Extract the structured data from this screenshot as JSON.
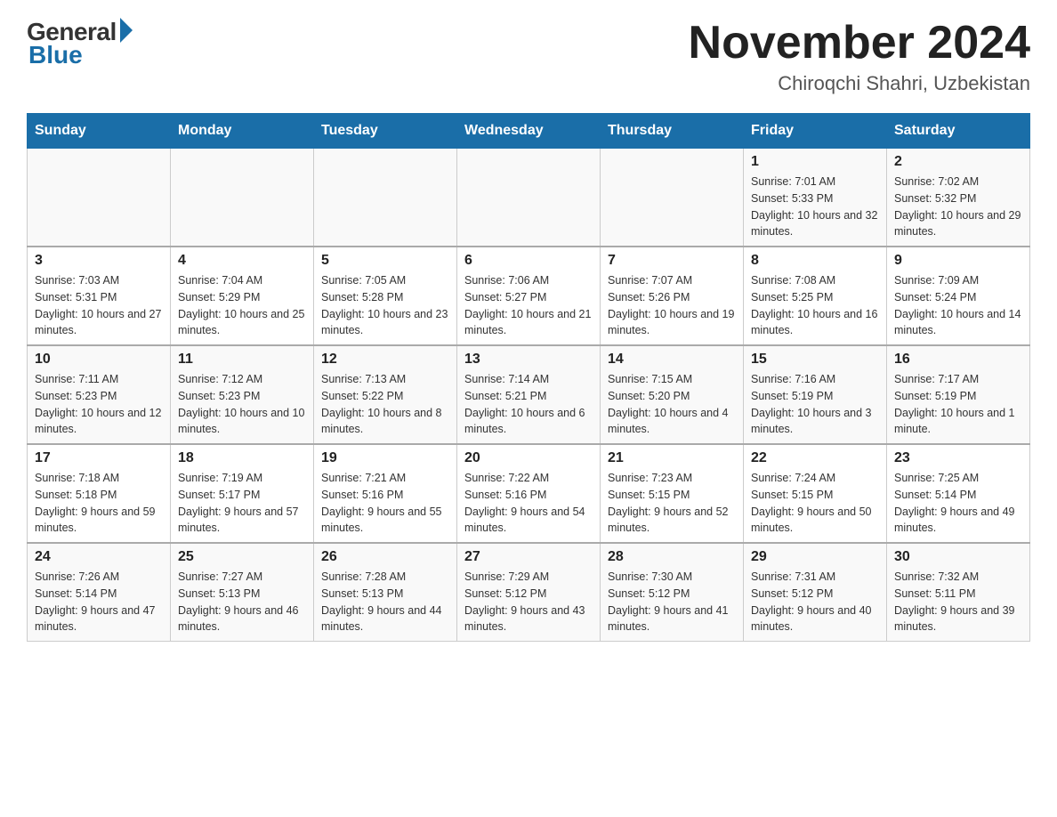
{
  "header": {
    "logo_general": "General",
    "logo_blue": "Blue",
    "month_title": "November 2024",
    "location": "Chiroqchi Shahri, Uzbekistan"
  },
  "weekdays": [
    "Sunday",
    "Monday",
    "Tuesday",
    "Wednesday",
    "Thursday",
    "Friday",
    "Saturday"
  ],
  "weeks": [
    [
      {
        "day": "",
        "sunrise": "",
        "sunset": "",
        "daylight": ""
      },
      {
        "day": "",
        "sunrise": "",
        "sunset": "",
        "daylight": ""
      },
      {
        "day": "",
        "sunrise": "",
        "sunset": "",
        "daylight": ""
      },
      {
        "day": "",
        "sunrise": "",
        "sunset": "",
        "daylight": ""
      },
      {
        "day": "",
        "sunrise": "",
        "sunset": "",
        "daylight": ""
      },
      {
        "day": "1",
        "sunrise": "Sunrise: 7:01 AM",
        "sunset": "Sunset: 5:33 PM",
        "daylight": "Daylight: 10 hours and 32 minutes."
      },
      {
        "day": "2",
        "sunrise": "Sunrise: 7:02 AM",
        "sunset": "Sunset: 5:32 PM",
        "daylight": "Daylight: 10 hours and 29 minutes."
      }
    ],
    [
      {
        "day": "3",
        "sunrise": "Sunrise: 7:03 AM",
        "sunset": "Sunset: 5:31 PM",
        "daylight": "Daylight: 10 hours and 27 minutes."
      },
      {
        "day": "4",
        "sunrise": "Sunrise: 7:04 AM",
        "sunset": "Sunset: 5:29 PM",
        "daylight": "Daylight: 10 hours and 25 minutes."
      },
      {
        "day": "5",
        "sunrise": "Sunrise: 7:05 AM",
        "sunset": "Sunset: 5:28 PM",
        "daylight": "Daylight: 10 hours and 23 minutes."
      },
      {
        "day": "6",
        "sunrise": "Sunrise: 7:06 AM",
        "sunset": "Sunset: 5:27 PM",
        "daylight": "Daylight: 10 hours and 21 minutes."
      },
      {
        "day": "7",
        "sunrise": "Sunrise: 7:07 AM",
        "sunset": "Sunset: 5:26 PM",
        "daylight": "Daylight: 10 hours and 19 minutes."
      },
      {
        "day": "8",
        "sunrise": "Sunrise: 7:08 AM",
        "sunset": "Sunset: 5:25 PM",
        "daylight": "Daylight: 10 hours and 16 minutes."
      },
      {
        "day": "9",
        "sunrise": "Sunrise: 7:09 AM",
        "sunset": "Sunset: 5:24 PM",
        "daylight": "Daylight: 10 hours and 14 minutes."
      }
    ],
    [
      {
        "day": "10",
        "sunrise": "Sunrise: 7:11 AM",
        "sunset": "Sunset: 5:23 PM",
        "daylight": "Daylight: 10 hours and 12 minutes."
      },
      {
        "day": "11",
        "sunrise": "Sunrise: 7:12 AM",
        "sunset": "Sunset: 5:23 PM",
        "daylight": "Daylight: 10 hours and 10 minutes."
      },
      {
        "day": "12",
        "sunrise": "Sunrise: 7:13 AM",
        "sunset": "Sunset: 5:22 PM",
        "daylight": "Daylight: 10 hours and 8 minutes."
      },
      {
        "day": "13",
        "sunrise": "Sunrise: 7:14 AM",
        "sunset": "Sunset: 5:21 PM",
        "daylight": "Daylight: 10 hours and 6 minutes."
      },
      {
        "day": "14",
        "sunrise": "Sunrise: 7:15 AM",
        "sunset": "Sunset: 5:20 PM",
        "daylight": "Daylight: 10 hours and 4 minutes."
      },
      {
        "day": "15",
        "sunrise": "Sunrise: 7:16 AM",
        "sunset": "Sunset: 5:19 PM",
        "daylight": "Daylight: 10 hours and 3 minutes."
      },
      {
        "day": "16",
        "sunrise": "Sunrise: 7:17 AM",
        "sunset": "Sunset: 5:19 PM",
        "daylight": "Daylight: 10 hours and 1 minute."
      }
    ],
    [
      {
        "day": "17",
        "sunrise": "Sunrise: 7:18 AM",
        "sunset": "Sunset: 5:18 PM",
        "daylight": "Daylight: 9 hours and 59 minutes."
      },
      {
        "day": "18",
        "sunrise": "Sunrise: 7:19 AM",
        "sunset": "Sunset: 5:17 PM",
        "daylight": "Daylight: 9 hours and 57 minutes."
      },
      {
        "day": "19",
        "sunrise": "Sunrise: 7:21 AM",
        "sunset": "Sunset: 5:16 PM",
        "daylight": "Daylight: 9 hours and 55 minutes."
      },
      {
        "day": "20",
        "sunrise": "Sunrise: 7:22 AM",
        "sunset": "Sunset: 5:16 PM",
        "daylight": "Daylight: 9 hours and 54 minutes."
      },
      {
        "day": "21",
        "sunrise": "Sunrise: 7:23 AM",
        "sunset": "Sunset: 5:15 PM",
        "daylight": "Daylight: 9 hours and 52 minutes."
      },
      {
        "day": "22",
        "sunrise": "Sunrise: 7:24 AM",
        "sunset": "Sunset: 5:15 PM",
        "daylight": "Daylight: 9 hours and 50 minutes."
      },
      {
        "day": "23",
        "sunrise": "Sunrise: 7:25 AM",
        "sunset": "Sunset: 5:14 PM",
        "daylight": "Daylight: 9 hours and 49 minutes."
      }
    ],
    [
      {
        "day": "24",
        "sunrise": "Sunrise: 7:26 AM",
        "sunset": "Sunset: 5:14 PM",
        "daylight": "Daylight: 9 hours and 47 minutes."
      },
      {
        "day": "25",
        "sunrise": "Sunrise: 7:27 AM",
        "sunset": "Sunset: 5:13 PM",
        "daylight": "Daylight: 9 hours and 46 minutes."
      },
      {
        "day": "26",
        "sunrise": "Sunrise: 7:28 AM",
        "sunset": "Sunset: 5:13 PM",
        "daylight": "Daylight: 9 hours and 44 minutes."
      },
      {
        "day": "27",
        "sunrise": "Sunrise: 7:29 AM",
        "sunset": "Sunset: 5:12 PM",
        "daylight": "Daylight: 9 hours and 43 minutes."
      },
      {
        "day": "28",
        "sunrise": "Sunrise: 7:30 AM",
        "sunset": "Sunset: 5:12 PM",
        "daylight": "Daylight: 9 hours and 41 minutes."
      },
      {
        "day": "29",
        "sunrise": "Sunrise: 7:31 AM",
        "sunset": "Sunset: 5:12 PM",
        "daylight": "Daylight: 9 hours and 40 minutes."
      },
      {
        "day": "30",
        "sunrise": "Sunrise: 7:32 AM",
        "sunset": "Sunset: 5:11 PM",
        "daylight": "Daylight: 9 hours and 39 minutes."
      }
    ]
  ]
}
